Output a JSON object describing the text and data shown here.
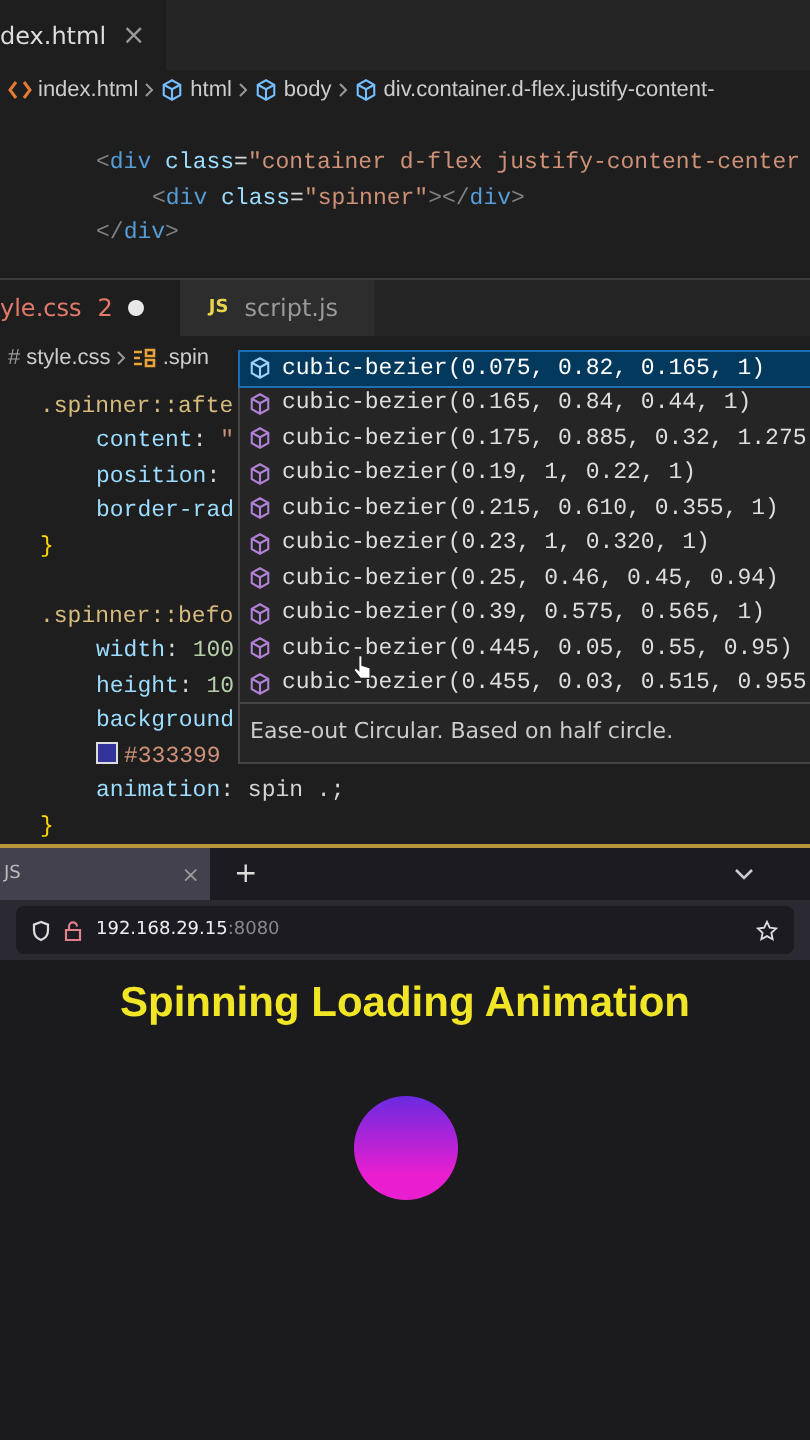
{
  "top_editor": {
    "tab": {
      "label": "dex.html",
      "close": "×"
    },
    "breadcrumbs": [
      {
        "label": "index.html",
        "kind": "file"
      },
      {
        "label": "html",
        "kind": "element"
      },
      {
        "label": "body",
        "kind": "element"
      },
      {
        "label": "div.container.d-flex.justify-content-",
        "kind": "element"
      }
    ],
    "lines": [
      {
        "tokens": [
          {
            "kind": "punct",
            "text": "<"
          },
          {
            "kind": "tag",
            "text": "div"
          },
          {
            "kind": "attr",
            "text": " class"
          },
          {
            "kind": "plain",
            "text": "="
          },
          {
            "kind": "string",
            "text": "\"container d-flex justify-content-center"
          }
        ],
        "children": [
          {
            "tokens": [
              {
                "kind": "punct",
                "text": "<"
              },
              {
                "kind": "tag",
                "text": "div"
              },
              {
                "kind": "attr",
                "text": " class"
              },
              {
                "kind": "plain",
                "text": "="
              },
              {
                "kind": "string",
                "text": "\"spinner\""
              },
              {
                "kind": "punct",
                "text": "></"
              },
              {
                "kind": "tag",
                "text": "div"
              },
              {
                "kind": "punct",
                "text": ">"
              }
            ]
          }
        ]
      },
      {
        "tokens": [
          {
            "kind": "punct",
            "text": "</"
          },
          {
            "kind": "tag",
            "text": "div"
          },
          {
            "kind": "punct",
            "text": ">"
          }
        ]
      }
    ]
  },
  "css_editor": {
    "tabs": [
      {
        "kind": "css",
        "label": "yle.css",
        "badge": "2",
        "modified": true,
        "selected": true
      },
      {
        "kind": "js",
        "icon": "JS",
        "label": "script.js",
        "modified": false,
        "selected": false
      }
    ],
    "breadcrumbs": [
      {
        "icon": "#",
        "label": "style.css",
        "kind": "file"
      },
      {
        "label": ".spin",
        "kind": "selector"
      }
    ],
    "rules": [
      {
        "lines": [
          {
            "tokens": [
              {
                "kind": "selector",
                "text": ".spinner::afte"
              }
            ],
            "children": [
              {
                "tokens": [
                  {
                    "kind": "prop",
                    "text": "content"
                  },
                  {
                    "kind": "plain",
                    "text": ": "
                  },
                  {
                    "kind": "string",
                    "text": "\""
                  }
                ]
              },
              {
                "tokens": [
                  {
                    "kind": "prop",
                    "text": "position"
                  },
                  {
                    "kind": "plain",
                    "text": ":"
                  }
                ]
              },
              {
                "tokens": [
                  {
                    "kind": "prop",
                    "text": "border-rad"
                  }
                ]
              }
            ]
          },
          {
            "tokens": [
              {
                "kind": "brace",
                "text": "}"
              }
            ]
          }
        ]
      },
      {
        "lines": [
          {
            "tokens": [
              {
                "kind": "selector",
                "text": ".spinner::befo"
              }
            ],
            "children": [
              {
                "tokens": [
                  {
                    "kind": "prop",
                    "text": "width"
                  },
                  {
                    "kind": "plain",
                    "text": ": "
                  },
                  {
                    "kind": "number",
                    "text": "100"
                  }
                ]
              },
              {
                "tokens": [
                  {
                    "kind": "prop",
                    "text": "height"
                  },
                  {
                    "kind": "plain",
                    "text": ": "
                  },
                  {
                    "kind": "number",
                    "text": "10"
                  }
                ]
              },
              {
                "tokens": [
                  {
                    "kind": "prop",
                    "text": "background"
                  }
                ]
              },
              {
                "tokens": [
                  {
                    "kind": "swatch",
                    "text": "#333399"
                  }
                ]
              },
              {
                "tokens": [
                  {
                    "kind": "prop",
                    "text": "animation"
                  },
                  {
                    "kind": "plain",
                    "text": ": spin .;"
                  }
                ]
              }
            ]
          },
          {
            "tokens": [
              {
                "kind": "brace",
                "text": "}"
              }
            ]
          }
        ]
      }
    ],
    "suggestions": [
      {
        "label": "cubic-bezier(0.075, 0.82, 0.165, 1)",
        "selected": true
      },
      {
        "label": "cubic-bezier(0.165, 0.84, 0.44, 1)",
        "selected": false
      },
      {
        "label": "cubic-bezier(0.175, 0.885, 0.32, 1.275",
        "selected": false
      },
      {
        "label": "cubic-bezier(0.19, 1, 0.22, 1)",
        "selected": false
      },
      {
        "label": "cubic-bezier(0.215, 0.610, 0.355, 1)",
        "selected": false
      },
      {
        "label": "cubic-bezier(0.23, 1, 0.320, 1)",
        "selected": false
      },
      {
        "label": "cubic-bezier(0.25, 0.46, 0.45, 0.94)",
        "selected": false
      },
      {
        "label": "cubic-bezier(0.39, 0.575, 0.565, 1)",
        "selected": false
      },
      {
        "label": "cubic-bezier(0.445, 0.05, 0.55, 0.95)",
        "selected": false
      },
      {
        "label": "cubic-bezier(0.455, 0.03, 0.515, 0.955",
        "selected": false
      }
    ],
    "suggestion_detail": "Ease-out Circular. Based on half circle."
  },
  "browser": {
    "tab": {
      "label": "JS",
      "close": "×"
    },
    "new_tab": "+",
    "url": {
      "host": "192.168.29.15",
      "port": ":8080"
    },
    "page": {
      "heading": "Spinning Loading Animation"
    }
  }
}
